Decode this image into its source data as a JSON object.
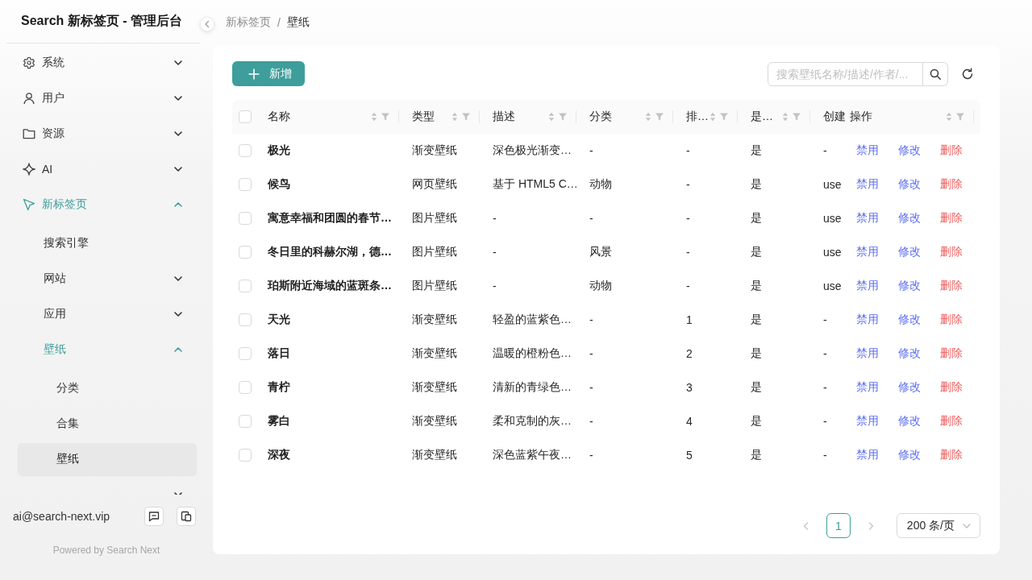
{
  "sidebar": {
    "title": "Search 新标签页 - 管理后台",
    "menu": [
      {
        "label": "系统",
        "kind": "submenu",
        "expanded": false,
        "selected": false
      },
      {
        "label": "用户",
        "kind": "submenu",
        "expanded": false,
        "selected": false
      },
      {
        "label": "资源",
        "kind": "submenu",
        "expanded": false,
        "selected": false
      },
      {
        "label": "AI",
        "kind": "submenu",
        "expanded": false,
        "selected": false
      },
      {
        "label": "新标签页",
        "kind": "submenu",
        "expanded": true,
        "selected": true,
        "children": [
          {
            "label": "搜索引擎",
            "kind": "item",
            "selected": false
          },
          {
            "label": "网站",
            "kind": "submenu",
            "expanded": false,
            "selected": false
          },
          {
            "label": "应用",
            "kind": "submenu",
            "expanded": false,
            "selected": false
          },
          {
            "label": "壁纸",
            "kind": "submenu",
            "expanded": true,
            "selected": true,
            "children": [
              {
                "label": "分类",
                "kind": "item",
                "selected": false
              },
              {
                "label": "合集",
                "kind": "item",
                "selected": false
              },
              {
                "label": "壁纸",
                "kind": "item",
                "selected": true
              }
            ]
          },
          {
            "kind": "submenu",
            "expanded": false,
            "selected": false
          }
        ]
      }
    ],
    "account": "ai@search-next.vip",
    "powered_by": "Powered by Search Next"
  },
  "breadcrumb": {
    "items": [
      "新标签页",
      "壁纸"
    ],
    "separator": "/"
  },
  "toolbar": {
    "add_button": {
      "label": "新增"
    },
    "search": {
      "placeholder": "搜索壁纸名称/描述/作者/..."
    }
  },
  "table": {
    "select_all": {
      "checked": false
    },
    "columns": [
      {
        "label": "名称",
        "sorter": true
      },
      {
        "label": "类型",
        "sorter": true
      },
      {
        "label": "描述",
        "sorter": true
      },
      {
        "label": "分类",
        "sorter": true
      },
      {
        "label": "排…",
        "sorter": true
      },
      {
        "label": "是…",
        "sorter": true
      },
      {
        "label": "创建",
        "sorter": false
      },
      {
        "label": "操作",
        "sorter": true
      }
    ],
    "rows": [
      {
        "checked": false,
        "cells": [
          "极光",
          "渐变壁纸",
          "深色极光渐变…",
          "-",
          "-",
          "是",
          "-"
        ],
        "actions": [
          {
            "label": "禁用",
            "kind": "link"
          },
          {
            "label": "修改",
            "kind": "link"
          },
          {
            "label": "删除",
            "kind": "danger"
          }
        ]
      },
      {
        "checked": false,
        "cells": [
          "候鸟",
          "网页壁纸",
          "基于 HTML5 C…",
          "动物",
          "-",
          "是",
          "use"
        ],
        "actions": [
          {
            "label": "禁用",
            "kind": "link"
          },
          {
            "label": "修改",
            "kind": "link"
          },
          {
            "label": "删除",
            "kind": "danger"
          }
        ]
      },
      {
        "checked": false,
        "cells": [
          "寓意幸福和团圆的春节…",
          "图片壁纸",
          "-",
          "-",
          "-",
          "是",
          "use"
        ],
        "actions": [
          {
            "label": "禁用",
            "kind": "link"
          },
          {
            "label": "修改",
            "kind": "link"
          },
          {
            "label": "删除",
            "kind": "danger"
          }
        ]
      },
      {
        "checked": false,
        "cells": [
          "冬日里的科赫尔湖，德…",
          "图片壁纸",
          "-",
          "风景",
          "-",
          "是",
          "use"
        ],
        "actions": [
          {
            "label": "禁用",
            "kind": "link"
          },
          {
            "label": "修改",
            "kind": "link"
          },
          {
            "label": "删除",
            "kind": "danger"
          }
        ]
      },
      {
        "checked": false,
        "cells": [
          "珀斯附近海域的蓝斑条…",
          "图片壁纸",
          "-",
          "动物",
          "-",
          "是",
          "use"
        ],
        "actions": [
          {
            "label": "禁用",
            "kind": "link"
          },
          {
            "label": "修改",
            "kind": "link"
          },
          {
            "label": "删除",
            "kind": "danger"
          }
        ]
      },
      {
        "checked": false,
        "cells": [
          "天光",
          "渐变壁纸",
          "轻盈的蓝紫色…",
          "-",
          "1",
          "是",
          "-"
        ],
        "actions": [
          {
            "label": "禁用",
            "kind": "link"
          },
          {
            "label": "修改",
            "kind": "link"
          },
          {
            "label": "删除",
            "kind": "danger"
          }
        ]
      },
      {
        "checked": false,
        "cells": [
          "落日",
          "渐变壁纸",
          "温暖的橙粉色…",
          "-",
          "2",
          "是",
          "-"
        ],
        "actions": [
          {
            "label": "禁用",
            "kind": "link"
          },
          {
            "label": "修改",
            "kind": "link"
          },
          {
            "label": "删除",
            "kind": "danger"
          }
        ]
      },
      {
        "checked": false,
        "cells": [
          "青柠",
          "渐变壁纸",
          "清新的青绿色…",
          "-",
          "3",
          "是",
          "-"
        ],
        "actions": [
          {
            "label": "禁用",
            "kind": "link"
          },
          {
            "label": "修改",
            "kind": "link"
          },
          {
            "label": "删除",
            "kind": "danger"
          }
        ]
      },
      {
        "checked": false,
        "cells": [
          "雾白",
          "渐变壁纸",
          "柔和克制的灰…",
          "-",
          "4",
          "是",
          "-"
        ],
        "actions": [
          {
            "label": "禁用",
            "kind": "link"
          },
          {
            "label": "修改",
            "kind": "link"
          },
          {
            "label": "删除",
            "kind": "danger"
          }
        ]
      },
      {
        "checked": false,
        "cells": [
          "深夜",
          "渐变壁纸",
          "深色蓝紫午夜…",
          "-",
          "5",
          "是",
          "-"
        ],
        "actions": [
          {
            "label": "禁用",
            "kind": "link"
          },
          {
            "label": "修改",
            "kind": "link"
          },
          {
            "label": "删除",
            "kind": "danger"
          }
        ]
      }
    ]
  },
  "pagination": {
    "prev": {
      "disabled": true
    },
    "pages": [
      {
        "label": "1",
        "selected": true
      }
    ],
    "next": {
      "disabled": true
    },
    "page_size": "200 条/页"
  }
}
